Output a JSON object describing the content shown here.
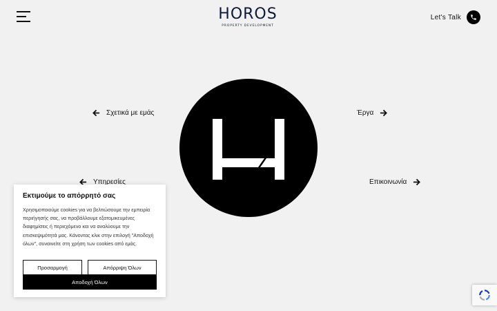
{
  "header": {
    "logo_word": "HOROS",
    "logo_sub": "PROPERTY DEVELOPMENT",
    "talk_label": "Let's Talk"
  },
  "nav": {
    "about": "Σχετικά με εμάς",
    "projects": "Έργα",
    "services": "Υπηρεσίες",
    "contact": "Επικοινωνία"
  },
  "cookie": {
    "title": "Εκτιμούμε το απόρρητό σας",
    "text": "Χρησιμοποιούμε cookies για να βελτιώσουμε την εμπειρία περιήγησής σας, να προβάλλουμε εξατομικευμένες διαφημίσεις ή περιεχόμενο και να αναλύουμε την επισκεψιμότητά μας. Κάνοντας κλικ στην επιλογή \"Αποδοχή όλων\", συναινείτε στη χρήση των cookies από εμάς.",
    "customize_label": "Προσαρμογή",
    "reject_label": "Απόρριψη Όλων",
    "accept_label": "Αποδοχή Όλων"
  },
  "icons": {
    "menu": "hamburger-menu-icon",
    "phone": "phone-icon",
    "arrow_left": "arrow-left-icon",
    "arrow_right": "arrow-right-icon",
    "recaptcha": "recaptcha-icon"
  },
  "colors": {
    "background": "#f1f1f1",
    "logo": "#0d1a36",
    "circle": "#000000",
    "accept_button": "#000000"
  }
}
